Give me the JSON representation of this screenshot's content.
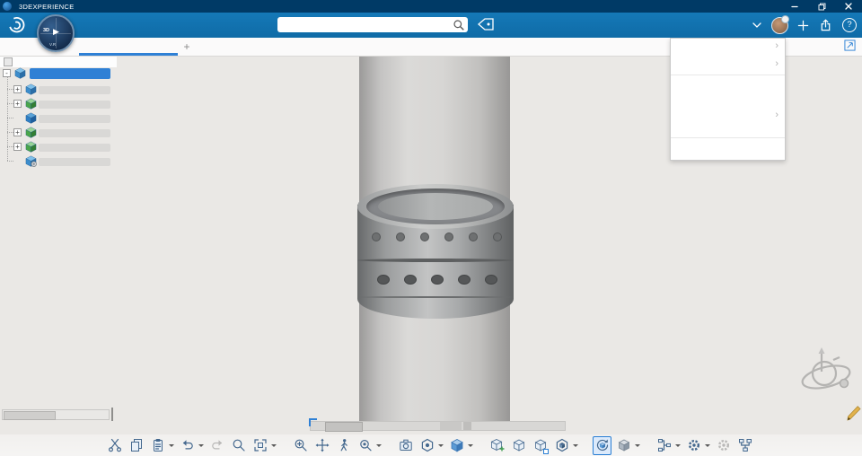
{
  "titlebar": {
    "title": "3DEXPERIENCE"
  },
  "appbar": {
    "compass": {
      "label_top": "3D",
      "play_glyph": "▶",
      "label_bottom": "V.R"
    },
    "search": {
      "value": ""
    },
    "help_glyph": "?"
  },
  "tabbar": {
    "new_tab_label": "+"
  },
  "tree": {
    "rows": [
      {
        "icon": "assembly",
        "expander": "-",
        "selected": true
      },
      {
        "icon": "component-blue",
        "expander": "+"
      },
      {
        "icon": "component-green",
        "expander": "+"
      },
      {
        "icon": "product",
        "expander": ""
      },
      {
        "icon": "component-green",
        "expander": "+"
      },
      {
        "icon": "component-green",
        "expander": "+"
      },
      {
        "icon": "representation",
        "expander": ""
      }
    ]
  },
  "user_menu": {
    "chevron": "›",
    "item_count": 3
  },
  "toolbar": {
    "buttons": [
      {
        "name": "cut"
      },
      {
        "name": "copy"
      },
      {
        "name": "paste",
        "caret": true
      },
      {
        "name": "undo",
        "caret": true
      },
      {
        "name": "redo",
        "disabled": true
      },
      {
        "name": "zoom-area"
      },
      {
        "name": "fit-all",
        "caret": true
      },
      {
        "name": "zoom",
        "gap": true
      },
      {
        "name": "pan"
      },
      {
        "name": "walk"
      },
      {
        "name": "examine",
        "caret": true
      },
      {
        "name": "capture",
        "gap": true
      },
      {
        "name": "view-settings",
        "caret": true
      },
      {
        "name": "render-style",
        "caret": true
      },
      {
        "name": "insert-component",
        "gap": true
      },
      {
        "name": "new-product"
      },
      {
        "name": "new-part",
        "marked": true
      },
      {
        "name": "shape-options",
        "caret": true
      },
      {
        "name": "update",
        "active": true,
        "gap": true
      },
      {
        "name": "manage-views",
        "caret": true
      },
      {
        "name": "design-tree",
        "caret": true,
        "gap": true
      },
      {
        "name": "graph-options",
        "caret": true
      },
      {
        "name": "settings-alt",
        "disabled": true
      },
      {
        "name": "structure-view"
      }
    ]
  },
  "colors": {
    "titlebar_bg": "#003a66",
    "appbar_bg": "#1172ae",
    "accent_blue": "#2f80d5",
    "selection_blue": "#2f80d5",
    "viewport_bg": "#eae8e5",
    "collar_dark": "#67696a"
  }
}
